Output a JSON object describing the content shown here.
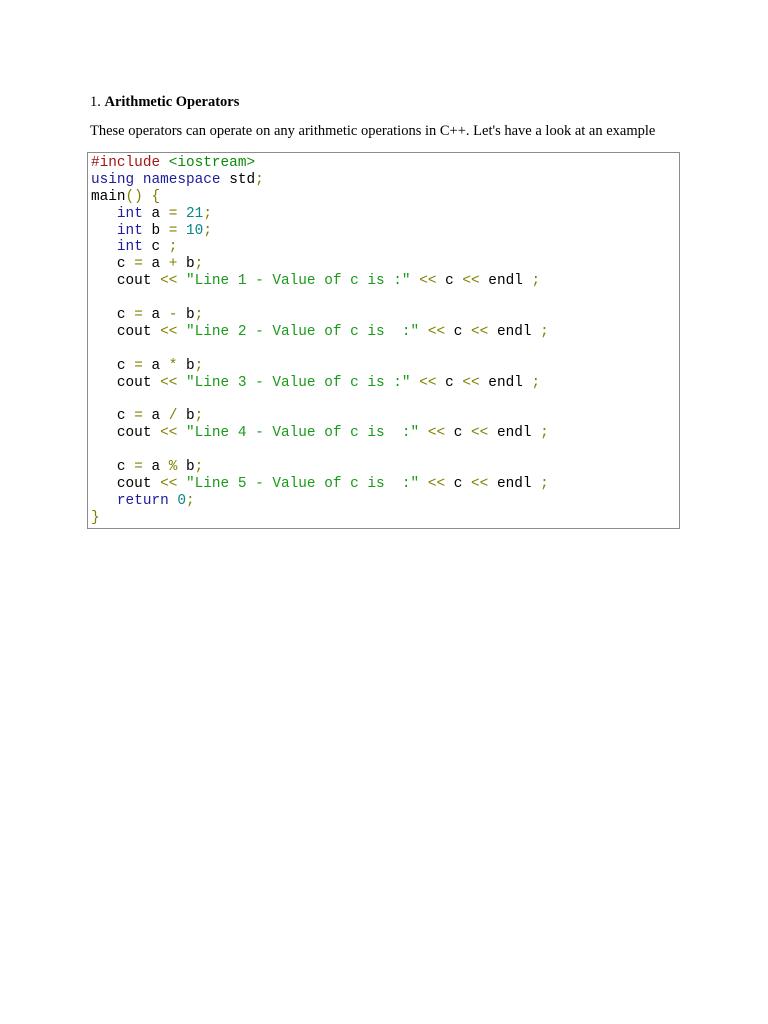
{
  "section": {
    "number": "1.",
    "title": "Arithmetic Operators",
    "intro": "These operators can operate on any arithmetic operations in C++. Let's have a look at an example"
  },
  "code_lines": [
    [
      {
        "t": "#include",
        "c": "pp"
      },
      {
        "t": " ",
        "c": "id"
      },
      {
        "t": "<iostream>",
        "c": "inc"
      }
    ],
    [
      {
        "t": "using",
        "c": "kw"
      },
      {
        "t": " ",
        "c": "id"
      },
      {
        "t": "namespace",
        "c": "kw"
      },
      {
        "t": " std",
        "c": "id"
      },
      {
        "t": ";",
        "c": "op"
      }
    ],
    [
      {
        "t": "main",
        "c": "id"
      },
      {
        "t": "() {",
        "c": "op"
      }
    ],
    [
      {
        "t": "   ",
        "c": "id"
      },
      {
        "t": "int",
        "c": "kw"
      },
      {
        "t": " a ",
        "c": "id"
      },
      {
        "t": "=",
        "c": "op"
      },
      {
        "t": " ",
        "c": "id"
      },
      {
        "t": "21",
        "c": "num"
      },
      {
        "t": ";",
        "c": "op"
      }
    ],
    [
      {
        "t": "   ",
        "c": "id"
      },
      {
        "t": "int",
        "c": "kw"
      },
      {
        "t": " b ",
        "c": "id"
      },
      {
        "t": "=",
        "c": "op"
      },
      {
        "t": " ",
        "c": "id"
      },
      {
        "t": "10",
        "c": "num"
      },
      {
        "t": ";",
        "c": "op"
      }
    ],
    [
      {
        "t": "   ",
        "c": "id"
      },
      {
        "t": "int",
        "c": "kw"
      },
      {
        "t": " c ",
        "c": "id"
      },
      {
        "t": ";",
        "c": "op"
      }
    ],
    [
      {
        "t": "   c ",
        "c": "id"
      },
      {
        "t": "=",
        "c": "op"
      },
      {
        "t": " a ",
        "c": "id"
      },
      {
        "t": "+",
        "c": "op"
      },
      {
        "t": " b",
        "c": "id"
      },
      {
        "t": ";",
        "c": "op"
      }
    ],
    [
      {
        "t": "   cout ",
        "c": "id"
      },
      {
        "t": "<<",
        "c": "op"
      },
      {
        "t": " ",
        "c": "id"
      },
      {
        "t": "\"Line 1 - Value of c is :\"",
        "c": "str"
      },
      {
        "t": " ",
        "c": "id"
      },
      {
        "t": "<<",
        "c": "op"
      },
      {
        "t": " c ",
        "c": "id"
      },
      {
        "t": "<<",
        "c": "op"
      },
      {
        "t": " endl ",
        "c": "id"
      },
      {
        "t": ";",
        "c": "op"
      }
    ],
    [],
    [
      {
        "t": "   c ",
        "c": "id"
      },
      {
        "t": "=",
        "c": "op"
      },
      {
        "t": " a ",
        "c": "id"
      },
      {
        "t": "-",
        "c": "op"
      },
      {
        "t": " b",
        "c": "id"
      },
      {
        "t": ";",
        "c": "op"
      }
    ],
    [
      {
        "t": "   cout ",
        "c": "id"
      },
      {
        "t": "<<",
        "c": "op"
      },
      {
        "t": " ",
        "c": "id"
      },
      {
        "t": "\"Line 2 - Value of c is  :\"",
        "c": "str"
      },
      {
        "t": " ",
        "c": "id"
      },
      {
        "t": "<<",
        "c": "op"
      },
      {
        "t": " c ",
        "c": "id"
      },
      {
        "t": "<<",
        "c": "op"
      },
      {
        "t": " endl ",
        "c": "id"
      },
      {
        "t": ";",
        "c": "op"
      }
    ],
    [],
    [
      {
        "t": "   c ",
        "c": "id"
      },
      {
        "t": "=",
        "c": "op"
      },
      {
        "t": " a ",
        "c": "id"
      },
      {
        "t": "*",
        "c": "op"
      },
      {
        "t": " b",
        "c": "id"
      },
      {
        "t": ";",
        "c": "op"
      }
    ],
    [
      {
        "t": "   cout ",
        "c": "id"
      },
      {
        "t": "<<",
        "c": "op"
      },
      {
        "t": " ",
        "c": "id"
      },
      {
        "t": "\"Line 3 - Value of c is :\"",
        "c": "str"
      },
      {
        "t": " ",
        "c": "id"
      },
      {
        "t": "<<",
        "c": "op"
      },
      {
        "t": " c ",
        "c": "id"
      },
      {
        "t": "<<",
        "c": "op"
      },
      {
        "t": " endl ",
        "c": "id"
      },
      {
        "t": ";",
        "c": "op"
      }
    ],
    [],
    [
      {
        "t": "   c ",
        "c": "id"
      },
      {
        "t": "=",
        "c": "op"
      },
      {
        "t": " a ",
        "c": "id"
      },
      {
        "t": "/",
        "c": "op"
      },
      {
        "t": " b",
        "c": "id"
      },
      {
        "t": ";",
        "c": "op"
      }
    ],
    [
      {
        "t": "   cout ",
        "c": "id"
      },
      {
        "t": "<<",
        "c": "op"
      },
      {
        "t": " ",
        "c": "id"
      },
      {
        "t": "\"Line 4 - Value of c is  :\"",
        "c": "str"
      },
      {
        "t": " ",
        "c": "id"
      },
      {
        "t": "<<",
        "c": "op"
      },
      {
        "t": " c ",
        "c": "id"
      },
      {
        "t": "<<",
        "c": "op"
      },
      {
        "t": " endl ",
        "c": "id"
      },
      {
        "t": ";",
        "c": "op"
      }
    ],
    [],
    [
      {
        "t": "   c ",
        "c": "id"
      },
      {
        "t": "=",
        "c": "op"
      },
      {
        "t": " a ",
        "c": "id"
      },
      {
        "t": "%",
        "c": "op"
      },
      {
        "t": " b",
        "c": "id"
      },
      {
        "t": ";",
        "c": "op"
      }
    ],
    [
      {
        "t": "   cout ",
        "c": "id"
      },
      {
        "t": "<<",
        "c": "op"
      },
      {
        "t": " ",
        "c": "id"
      },
      {
        "t": "\"Line 5 - Value of c is  :\"",
        "c": "str"
      },
      {
        "t": " ",
        "c": "id"
      },
      {
        "t": "<<",
        "c": "op"
      },
      {
        "t": " c ",
        "c": "id"
      },
      {
        "t": "<<",
        "c": "op"
      },
      {
        "t": " endl ",
        "c": "id"
      },
      {
        "t": ";",
        "c": "op"
      }
    ],
    [
      {
        "t": "   ",
        "c": "id"
      },
      {
        "t": "return",
        "c": "kw"
      },
      {
        "t": " ",
        "c": "id"
      },
      {
        "t": "0",
        "c": "num"
      },
      {
        "t": ";",
        "c": "op"
      }
    ],
    [
      {
        "t": "}",
        "c": "op"
      }
    ]
  ],
  "colors": {
    "preprocessor": "#a31515",
    "include_target": "#0a8a0a",
    "keyword": "#1c1c9c",
    "operator": "#808000",
    "number": "#098686",
    "string": "#1a9a1a",
    "identifier": "#000000",
    "code_border": "#8c8c8c"
  }
}
